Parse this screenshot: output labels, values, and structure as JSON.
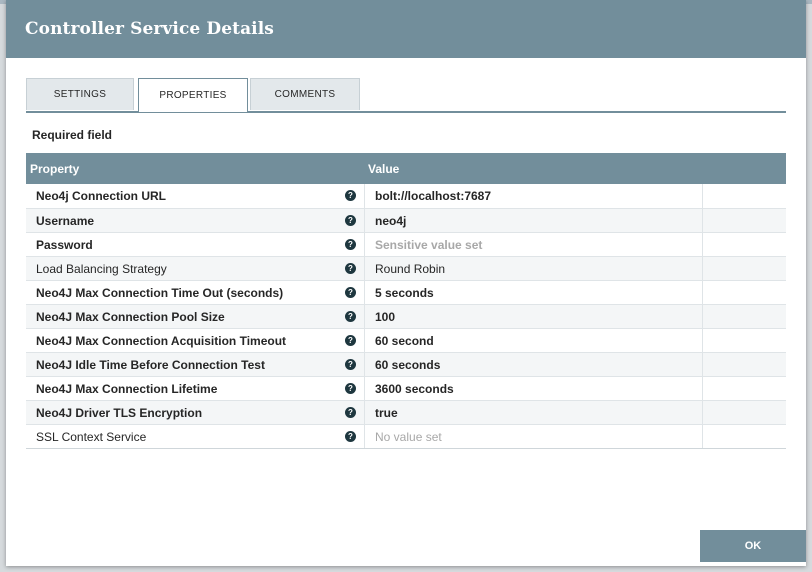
{
  "dialog": {
    "title": "Controller Service Details"
  },
  "tabs": [
    {
      "label": "SETTINGS",
      "active": false
    },
    {
      "label": "PROPERTIES",
      "active": true
    },
    {
      "label": "COMMENTS",
      "active": false
    }
  ],
  "required_label": "Required field",
  "grid": {
    "columns": {
      "property": "Property",
      "value": "Value"
    },
    "help_glyph": "?",
    "rows": [
      {
        "property": "Neo4j Connection URL",
        "value": "bolt://localhost:7687",
        "required": true,
        "value_style": "normal"
      },
      {
        "property": "Username",
        "value": "neo4j",
        "required": true,
        "value_style": "normal"
      },
      {
        "property": "Password",
        "value": "Sensitive value set",
        "required": true,
        "value_style": "muted"
      },
      {
        "property": "Load Balancing Strategy",
        "value": "Round Robin",
        "required": false,
        "value_style": "plain"
      },
      {
        "property": "Neo4J Max Connection Time Out (seconds)",
        "value": "5 seconds",
        "required": true,
        "value_style": "normal"
      },
      {
        "property": "Neo4J Max Connection Pool Size",
        "value": "100",
        "required": true,
        "value_style": "normal"
      },
      {
        "property": "Neo4J Max Connection Acquisition Timeout",
        "value": "60 second",
        "required": true,
        "value_style": "normal"
      },
      {
        "property": "Neo4J Idle Time Before Connection Test",
        "value": "60 seconds",
        "required": true,
        "value_style": "normal"
      },
      {
        "property": "Neo4J Max Connection Lifetime",
        "value": "3600 seconds",
        "required": true,
        "value_style": "normal"
      },
      {
        "property": "Neo4J Driver TLS Encryption",
        "value": "true",
        "required": true,
        "value_style": "normal"
      },
      {
        "property": "SSL Context Service",
        "value": "No value set",
        "required": false,
        "value_style": "muted-plain"
      }
    ]
  },
  "footer": {
    "ok_label": "OK"
  },
  "colors": {
    "header_bg": "#728e9b",
    "help_icon": "#1e373f"
  },
  "icons": {
    "help": "help-icon"
  }
}
